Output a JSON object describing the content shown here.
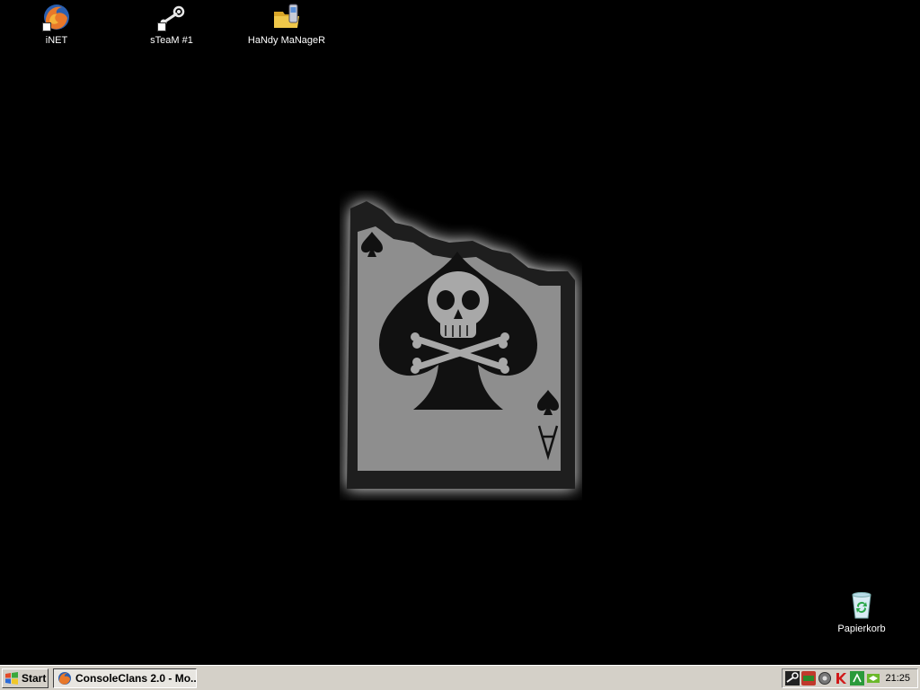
{
  "desktop": {
    "background": "#000000",
    "icons": [
      {
        "label": "iNET",
        "icon": "firefox-icon"
      },
      {
        "label": "sTeaM #1",
        "icon": "steam-icon"
      },
      {
        "label": "HaNdy MaNageR",
        "icon": "folder-phone-icon"
      },
      {
        "label": "Papierkorb",
        "icon": "recycle-bin-icon"
      }
    ]
  },
  "taskbar": {
    "start_label": "Start",
    "task_label": "ConsoleClans 2.0 - Mo...",
    "tray_icons": [
      "steam-tray-icon",
      "nvidia-tray-icon",
      "audio-tray-icon",
      "kaspersky-tray-icon",
      "network-tray-icon",
      "nvidia-settings-tray-icon"
    ],
    "clock": "21:25"
  }
}
